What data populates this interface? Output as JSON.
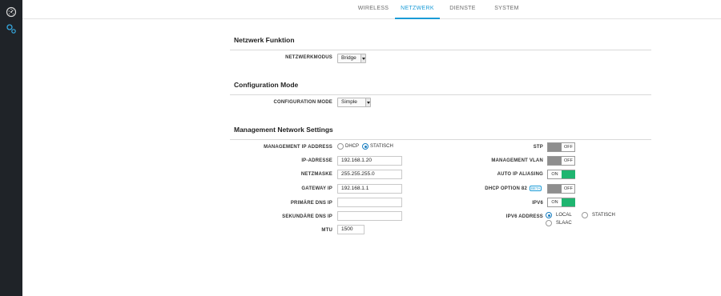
{
  "sidebar": {
    "items": [
      {
        "icon": "dashboard-icon"
      },
      {
        "icon": "settings-gears-icon"
      }
    ]
  },
  "tabs": [
    {
      "label": "WIRELESS",
      "active": false
    },
    {
      "label": "NETZWERK",
      "active": true
    },
    {
      "label": "DIENSTE",
      "active": false
    },
    {
      "label": "SYSTEM",
      "active": false
    }
  ],
  "netzwerk_funktion": {
    "title": "Netzwerk Funktion",
    "mode_label": "NETZWERKMODUS",
    "mode_value": "Bridge"
  },
  "configuration_mode": {
    "title": "Configuration Mode",
    "label": "CONFIGURATION MODE",
    "value": "Simple"
  },
  "management": {
    "title": "Management Network Settings",
    "ip_address_label": "MANAGEMENT IP ADDRESS",
    "dhcp_label": "DHCP",
    "static_label": "STATISCH",
    "ip_mode_selected": "STATISCH",
    "fields": {
      "ip_label": "IP-ADRESSE",
      "ip_value": "192.168.1.20",
      "mask_label": "NETZMASKE",
      "mask_value": "255.255.255.0",
      "gateway_label": "GATEWAY IP",
      "gateway_value": "192.168.1.1",
      "dns1_label": "PRIMÄRE DNS IP",
      "dns1_value": "",
      "dns2_label": "SEKUNDÄRE DNS IP",
      "dns2_value": "",
      "mtu_label": "MTU",
      "mtu_value": "1500"
    },
    "toggles": {
      "stp_label": "STP",
      "stp_state": "OFF",
      "vlan_label": "MANAGEMENT VLAN",
      "vlan_state": "OFF",
      "alias_label": "AUTO IP ALIASING",
      "alias_state": "ON",
      "dhcp82_label": "DHCP OPTION 82",
      "dhcp82_badge": "BETA",
      "dhcp82_state": "OFF",
      "ipv6_label": "IPV6",
      "ipv6_state": "ON"
    },
    "ipv6_address_label": "IPV6 ADDRESS",
    "ipv6_options": [
      "LOCAL",
      "STATISCH",
      "SLAAC"
    ],
    "ipv6_selected": "LOCAL"
  },
  "colors": {
    "accent": "#1a9bd7",
    "toggle_on": "#1fb570",
    "toggle_off": "#8e8e8e",
    "sidebar": "#1f2328"
  }
}
